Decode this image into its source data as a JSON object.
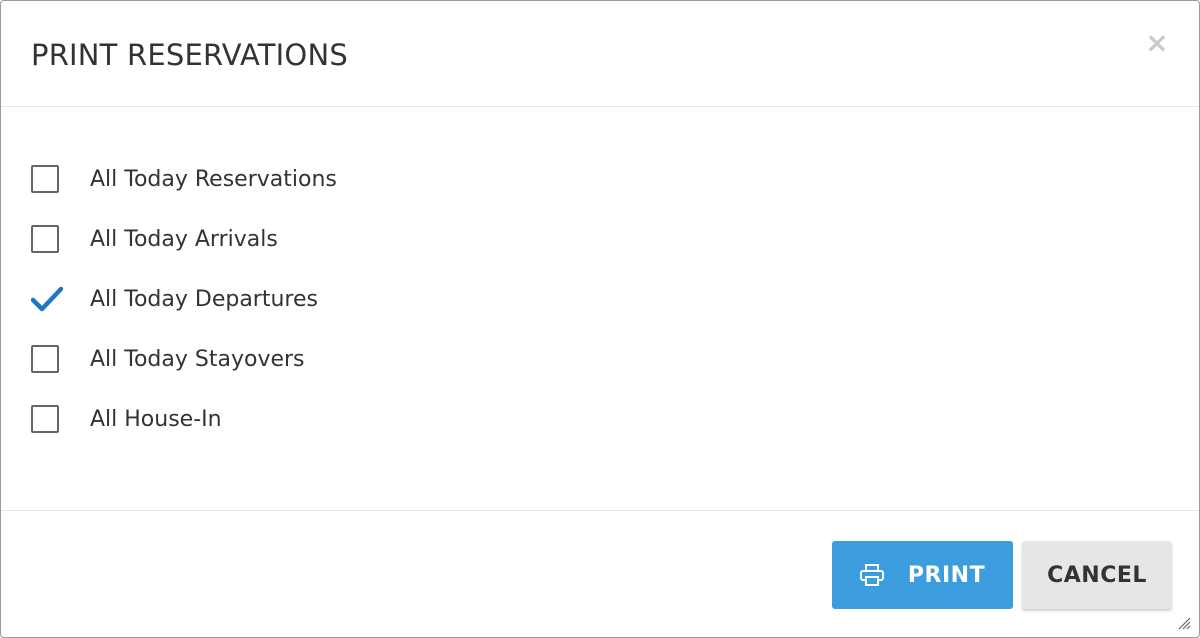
{
  "dialog": {
    "title": "PRINT RESERVATIONS",
    "close_glyph": "×"
  },
  "options": [
    {
      "label": "All Today Reservations",
      "checked": false
    },
    {
      "label": "All Today Arrivals",
      "checked": false
    },
    {
      "label": "All Today Departures",
      "checked": true
    },
    {
      "label": "All Today Stayovers",
      "checked": false
    },
    {
      "label": "All House-In",
      "checked": false
    }
  ],
  "footer": {
    "print_label": "PRINT",
    "print_icon": "printer-icon",
    "cancel_label": "CANCEL"
  },
  "colors": {
    "accent": "#3b9ddd",
    "check": "#1d78c1",
    "cancel_bg": "#e6e6e6"
  }
}
